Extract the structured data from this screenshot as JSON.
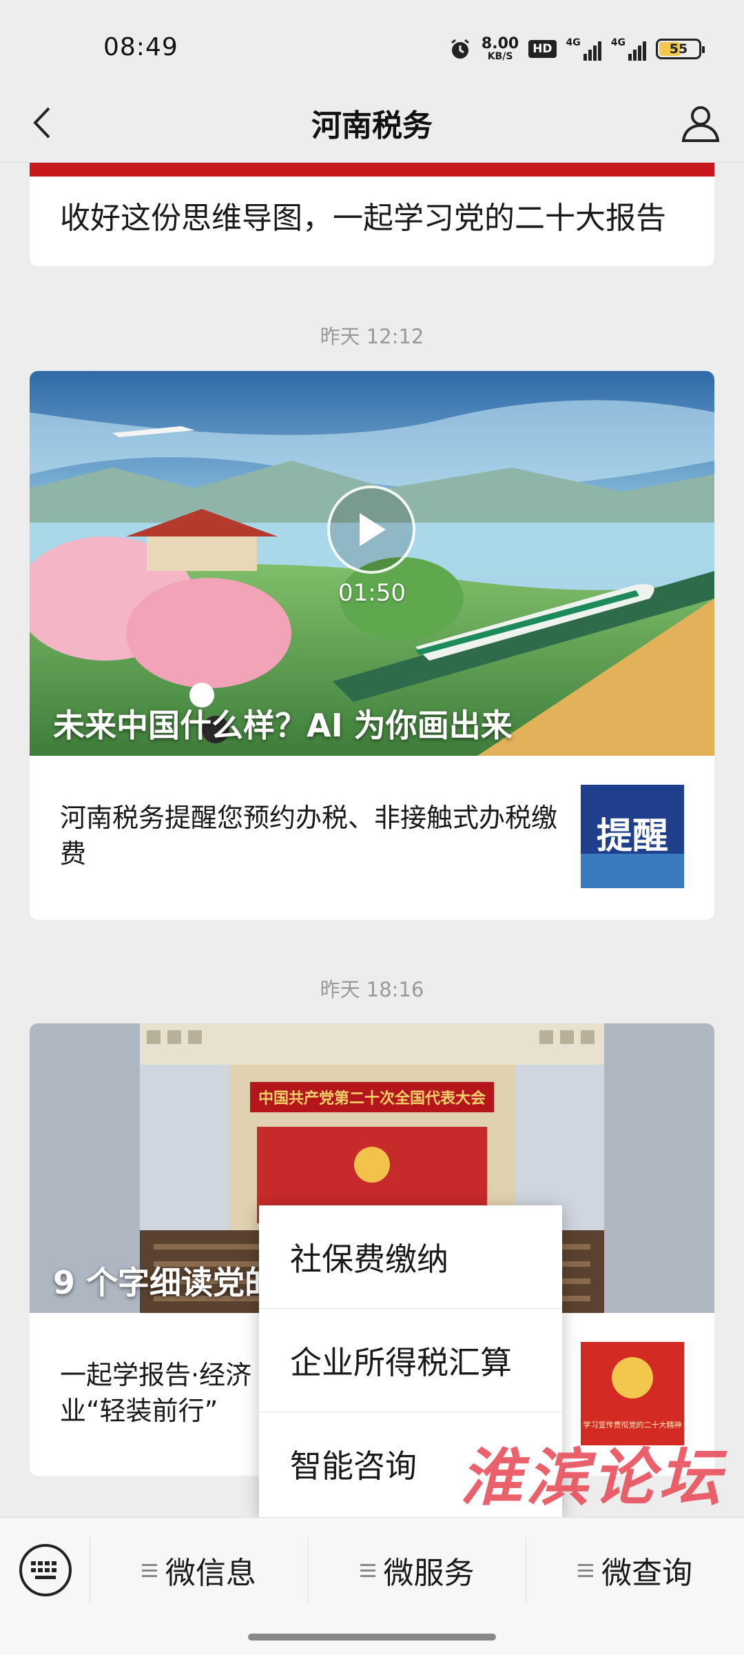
{
  "status_bar": {
    "time": "08:49",
    "net_speed_value": "8.00",
    "net_speed_unit": "KB/S",
    "hd_badge": "HD",
    "signal1": "4G",
    "signal2": "4G",
    "battery_level": "55",
    "battery_fraction": 0.55
  },
  "header": {
    "title": "河南税务"
  },
  "feed": {
    "article_top_title": "收好这份思维导图，一起学习党的二十大报告",
    "group1": {
      "timestamp": "昨天 12:12",
      "hero_title": "未来中国什么样？AI 为你画出来",
      "video_duration": "01:50",
      "sub_title": "河南税务提醒您预约办税、非接触式办税缴费",
      "thumb_text": "提醒"
    },
    "group2": {
      "timestamp": "昨天 18:16",
      "banner_text": "中国共产党第二十次全国代表大会",
      "hero_title": "9 个字细读党的",
      "sub_title": "一起学报告·经济\n业“轻装前行”",
      "thumb_text": "学习宣传贯彻党的二十大精神"
    }
  },
  "popup_menu": {
    "items": [
      "社保费缴纳",
      "企业所得税汇算",
      "智能咨询"
    ]
  },
  "watermark": "淮滨论坛",
  "bottom_bar": {
    "tabs": [
      "微信息",
      "微服务",
      "微查询"
    ]
  },
  "colors": {
    "accent_red": "#c9171e",
    "watermark": "#e8505b"
  }
}
